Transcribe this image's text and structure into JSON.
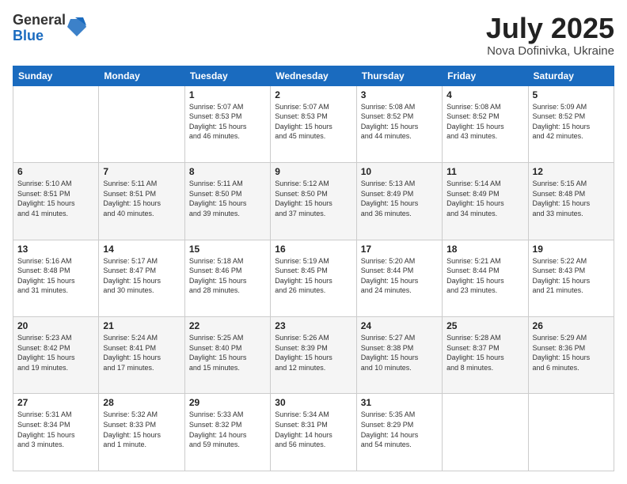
{
  "logo": {
    "general": "General",
    "blue": "Blue"
  },
  "title": {
    "month": "July 2025",
    "location": "Nova Dofinivka, Ukraine"
  },
  "weekdays": [
    "Sunday",
    "Monday",
    "Tuesday",
    "Wednesday",
    "Thursday",
    "Friday",
    "Saturday"
  ],
  "weeks": [
    [
      {
        "day": "",
        "info": ""
      },
      {
        "day": "",
        "info": ""
      },
      {
        "day": "1",
        "info": "Sunrise: 5:07 AM\nSunset: 8:53 PM\nDaylight: 15 hours\nand 46 minutes."
      },
      {
        "day": "2",
        "info": "Sunrise: 5:07 AM\nSunset: 8:53 PM\nDaylight: 15 hours\nand 45 minutes."
      },
      {
        "day": "3",
        "info": "Sunrise: 5:08 AM\nSunset: 8:52 PM\nDaylight: 15 hours\nand 44 minutes."
      },
      {
        "day": "4",
        "info": "Sunrise: 5:08 AM\nSunset: 8:52 PM\nDaylight: 15 hours\nand 43 minutes."
      },
      {
        "day": "5",
        "info": "Sunrise: 5:09 AM\nSunset: 8:52 PM\nDaylight: 15 hours\nand 42 minutes."
      }
    ],
    [
      {
        "day": "6",
        "info": "Sunrise: 5:10 AM\nSunset: 8:51 PM\nDaylight: 15 hours\nand 41 minutes."
      },
      {
        "day": "7",
        "info": "Sunrise: 5:11 AM\nSunset: 8:51 PM\nDaylight: 15 hours\nand 40 minutes."
      },
      {
        "day": "8",
        "info": "Sunrise: 5:11 AM\nSunset: 8:50 PM\nDaylight: 15 hours\nand 39 minutes."
      },
      {
        "day": "9",
        "info": "Sunrise: 5:12 AM\nSunset: 8:50 PM\nDaylight: 15 hours\nand 37 minutes."
      },
      {
        "day": "10",
        "info": "Sunrise: 5:13 AM\nSunset: 8:49 PM\nDaylight: 15 hours\nand 36 minutes."
      },
      {
        "day": "11",
        "info": "Sunrise: 5:14 AM\nSunset: 8:49 PM\nDaylight: 15 hours\nand 34 minutes."
      },
      {
        "day": "12",
        "info": "Sunrise: 5:15 AM\nSunset: 8:48 PM\nDaylight: 15 hours\nand 33 minutes."
      }
    ],
    [
      {
        "day": "13",
        "info": "Sunrise: 5:16 AM\nSunset: 8:48 PM\nDaylight: 15 hours\nand 31 minutes."
      },
      {
        "day": "14",
        "info": "Sunrise: 5:17 AM\nSunset: 8:47 PM\nDaylight: 15 hours\nand 30 minutes."
      },
      {
        "day": "15",
        "info": "Sunrise: 5:18 AM\nSunset: 8:46 PM\nDaylight: 15 hours\nand 28 minutes."
      },
      {
        "day": "16",
        "info": "Sunrise: 5:19 AM\nSunset: 8:45 PM\nDaylight: 15 hours\nand 26 minutes."
      },
      {
        "day": "17",
        "info": "Sunrise: 5:20 AM\nSunset: 8:44 PM\nDaylight: 15 hours\nand 24 minutes."
      },
      {
        "day": "18",
        "info": "Sunrise: 5:21 AM\nSunset: 8:44 PM\nDaylight: 15 hours\nand 23 minutes."
      },
      {
        "day": "19",
        "info": "Sunrise: 5:22 AM\nSunset: 8:43 PM\nDaylight: 15 hours\nand 21 minutes."
      }
    ],
    [
      {
        "day": "20",
        "info": "Sunrise: 5:23 AM\nSunset: 8:42 PM\nDaylight: 15 hours\nand 19 minutes."
      },
      {
        "day": "21",
        "info": "Sunrise: 5:24 AM\nSunset: 8:41 PM\nDaylight: 15 hours\nand 17 minutes."
      },
      {
        "day": "22",
        "info": "Sunrise: 5:25 AM\nSunset: 8:40 PM\nDaylight: 15 hours\nand 15 minutes."
      },
      {
        "day": "23",
        "info": "Sunrise: 5:26 AM\nSunset: 8:39 PM\nDaylight: 15 hours\nand 12 minutes."
      },
      {
        "day": "24",
        "info": "Sunrise: 5:27 AM\nSunset: 8:38 PM\nDaylight: 15 hours\nand 10 minutes."
      },
      {
        "day": "25",
        "info": "Sunrise: 5:28 AM\nSunset: 8:37 PM\nDaylight: 15 hours\nand 8 minutes."
      },
      {
        "day": "26",
        "info": "Sunrise: 5:29 AM\nSunset: 8:36 PM\nDaylight: 15 hours\nand 6 minutes."
      }
    ],
    [
      {
        "day": "27",
        "info": "Sunrise: 5:31 AM\nSunset: 8:34 PM\nDaylight: 15 hours\nand 3 minutes."
      },
      {
        "day": "28",
        "info": "Sunrise: 5:32 AM\nSunset: 8:33 PM\nDaylight: 15 hours\nand 1 minute."
      },
      {
        "day": "29",
        "info": "Sunrise: 5:33 AM\nSunset: 8:32 PM\nDaylight: 14 hours\nand 59 minutes."
      },
      {
        "day": "30",
        "info": "Sunrise: 5:34 AM\nSunset: 8:31 PM\nDaylight: 14 hours\nand 56 minutes."
      },
      {
        "day": "31",
        "info": "Sunrise: 5:35 AM\nSunset: 8:29 PM\nDaylight: 14 hours\nand 54 minutes."
      },
      {
        "day": "",
        "info": ""
      },
      {
        "day": "",
        "info": ""
      }
    ]
  ]
}
